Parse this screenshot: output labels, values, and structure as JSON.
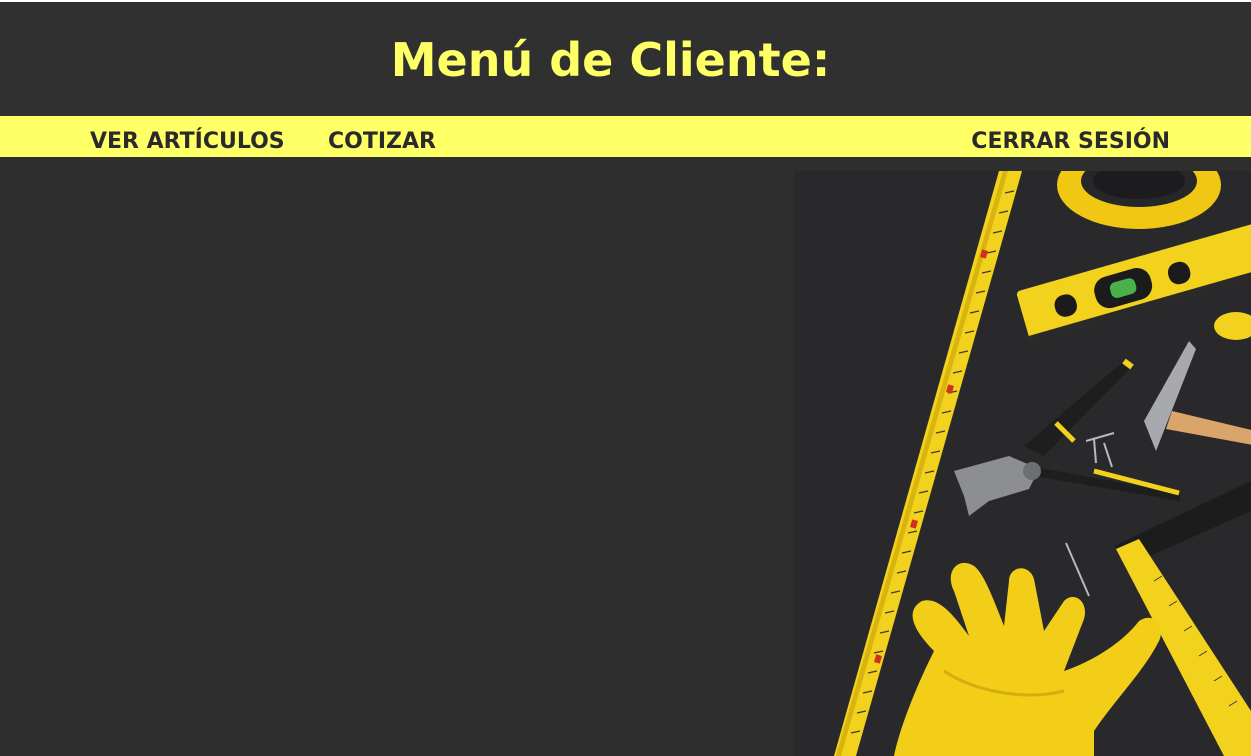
{
  "header": {
    "title": "Menú de Cliente:"
  },
  "nav": {
    "ver_articulos": "VER ARTÍCULOS",
    "cotizar": "COTIZAR",
    "cerrar_sesion": "CERRAR SESIÓN"
  },
  "hero_image": {
    "subject": "tools-on-dark-background",
    "items": [
      "measuring-tape",
      "level",
      "pliers",
      "hammer",
      "nails",
      "work-gloves",
      "carpenter-square",
      "tape-roll"
    ]
  },
  "colors": {
    "background": "#2e2e2e",
    "accent": "#ffff66",
    "nav_text": "#2a2a2a"
  }
}
